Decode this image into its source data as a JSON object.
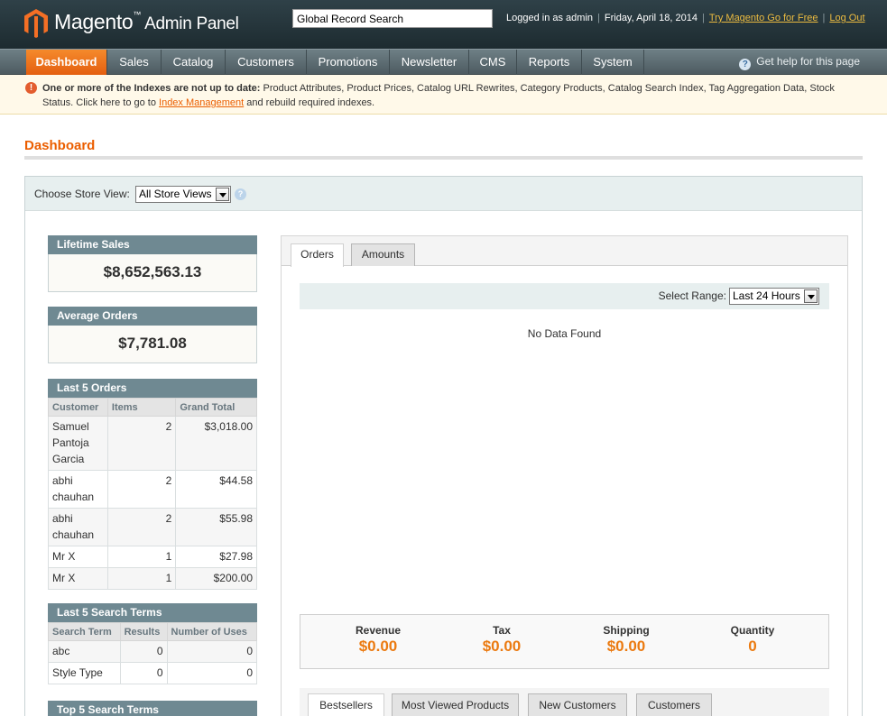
{
  "header": {
    "logo_name": "Magento",
    "logo_sub": "Admin Panel",
    "search_value": "Global Record Search",
    "logged_in": "Logged in as admin",
    "date": "Friday, April 18, 2014",
    "try_link": "Try Magento Go for Free",
    "logout": "Log Out"
  },
  "nav": {
    "items": [
      "Dashboard",
      "Sales",
      "Catalog",
      "Customers",
      "Promotions",
      "Newsletter",
      "CMS",
      "Reports",
      "System"
    ],
    "active": "Dashboard",
    "help": "Get help for this page"
  },
  "notice": {
    "bold": "One or more of the Indexes are not up to date:",
    "text": " Product Attributes, Product Prices, Catalog URL Rewrites, Category Products, Catalog Search Index, Tag Aggregation Data, Stock Status. Click here to go to ",
    "link": "Index Management",
    "tail": " and rebuild required indexes."
  },
  "page_title": "Dashboard",
  "store_view": {
    "label": "Choose Store View:",
    "value": "All Store Views"
  },
  "lifetime_sales": {
    "title": "Lifetime Sales",
    "value": "$8,652,563.13"
  },
  "average_orders": {
    "title": "Average Orders",
    "value": "$7,781.08"
  },
  "last_orders": {
    "title": "Last 5 Orders",
    "columns": [
      "Customer",
      "Items",
      "Grand Total"
    ],
    "rows": [
      [
        "Samuel Pantoja Garcia",
        "2",
        "$3,018.00"
      ],
      [
        "abhi chauhan",
        "2",
        "$44.58"
      ],
      [
        "abhi chauhan",
        "2",
        "$55.98"
      ],
      [
        "Mr X",
        "1",
        "$27.98"
      ],
      [
        "Mr X",
        "1",
        "$200.00"
      ]
    ]
  },
  "last_search": {
    "title": "Last 5 Search Terms",
    "columns": [
      "Search Term",
      "Results",
      "Number of Uses"
    ],
    "rows": [
      [
        "abc",
        "0",
        "0"
      ],
      [
        "Style Type",
        "0",
        "0"
      ]
    ]
  },
  "top_search": {
    "title": "Top 5 Search Terms"
  },
  "chart": {
    "tabs": [
      "Orders",
      "Amounts"
    ],
    "range_label": "Select Range:",
    "range_value": "Last 24 Hours",
    "no_data": "No Data Found"
  },
  "totals": [
    {
      "label": "Revenue",
      "value": "$0.00"
    },
    {
      "label": "Tax",
      "value": "$0.00"
    },
    {
      "label": "Shipping",
      "value": "$0.00"
    },
    {
      "label": "Quantity",
      "value": "0"
    }
  ],
  "bottom_tabs": [
    "Bestsellers",
    "Most Viewed Products",
    "New Customers",
    "Customers"
  ],
  "colors": {
    "accent": "#eb5e00",
    "header": "#1d2b30",
    "total_value": "#eb7a10"
  }
}
